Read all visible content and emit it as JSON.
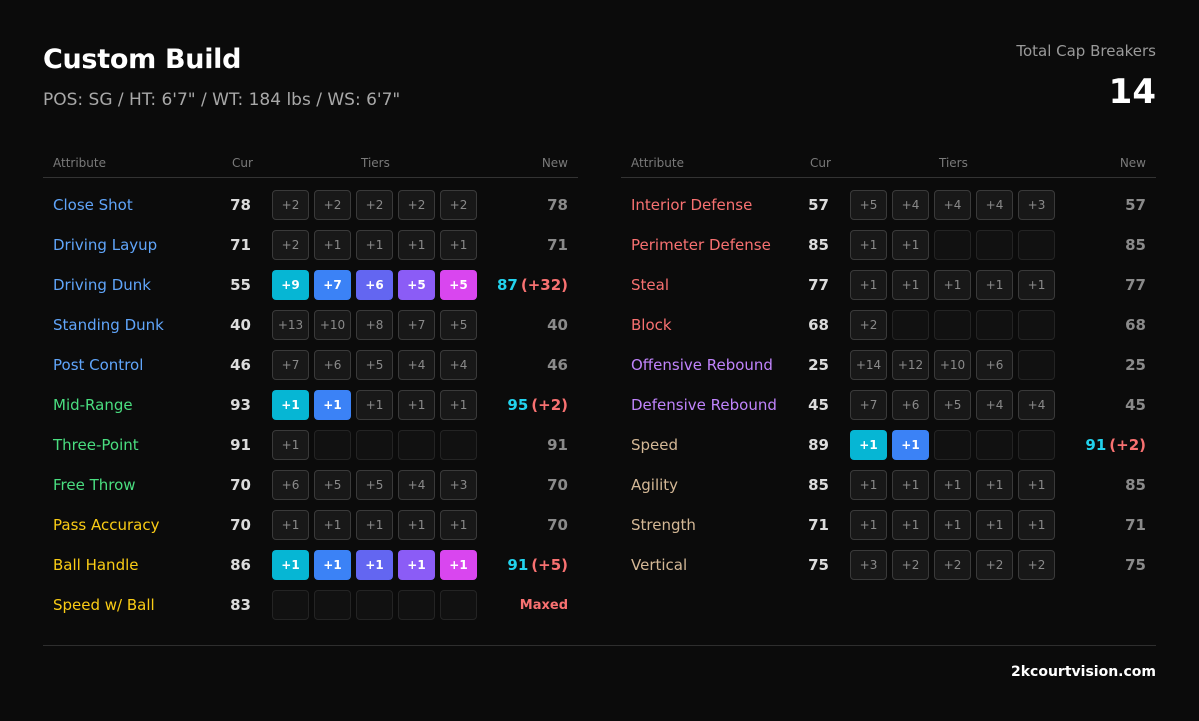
{
  "header": {
    "title": "Custom Build",
    "subtitle": "POS: SG / HT: 6'7\" / WT: 184 lbs / WS: 6'7\"",
    "cap_label": "Total Cap Breakers",
    "cap_value": "14"
  },
  "columns": {
    "attribute": "Attribute",
    "cur": "Cur",
    "tiers": "Tiers",
    "new": "New"
  },
  "colors": {
    "finishing": "#60a5fa",
    "shooting": "#4ade80",
    "playmaking": "#facc15",
    "defense": "#f87171",
    "rebounding": "#c084fc",
    "physical": "#d4b896",
    "tier_gradient": [
      "#06b6d4",
      "#3b82f6",
      "#6366f1",
      "#8b5cf6",
      "#d946ef"
    ]
  },
  "left": [
    {
      "name": "Close Shot",
      "group": "finishing",
      "cur": "78",
      "tiers": [
        "+2",
        "+2",
        "+2",
        "+2",
        "+2"
      ],
      "active": 0,
      "new": "78"
    },
    {
      "name": "Driving Layup",
      "group": "finishing",
      "cur": "71",
      "tiers": [
        "+2",
        "+1",
        "+1",
        "+1",
        "+1"
      ],
      "active": 0,
      "new": "71"
    },
    {
      "name": "Driving Dunk",
      "group": "finishing",
      "cur": "55",
      "tiers": [
        "+9",
        "+7",
        "+6",
        "+5",
        "+5"
      ],
      "active": 5,
      "new": "87",
      "delta": "(+32)"
    },
    {
      "name": "Standing Dunk",
      "group": "finishing",
      "cur": "40",
      "tiers": [
        "+13",
        "+10",
        "+8",
        "+7",
        "+5"
      ],
      "active": 0,
      "new": "40"
    },
    {
      "name": "Post Control",
      "group": "finishing",
      "cur": "46",
      "tiers": [
        "+7",
        "+6",
        "+5",
        "+4",
        "+4"
      ],
      "active": 0,
      "new": "46"
    },
    {
      "name": "Mid-Range",
      "group": "shooting",
      "cur": "93",
      "tiers": [
        "+1",
        "+1",
        "+1",
        "+1",
        "+1"
      ],
      "active": 2,
      "new": "95",
      "delta": "(+2)"
    },
    {
      "name": "Three-Point",
      "group": "shooting",
      "cur": "91",
      "tiers": [
        "+1",
        "",
        "",
        "",
        ""
      ],
      "active": 0,
      "new": "91"
    },
    {
      "name": "Free Throw",
      "group": "shooting",
      "cur": "70",
      "tiers": [
        "+6",
        "+5",
        "+5",
        "+4",
        "+3"
      ],
      "active": 0,
      "new": "70"
    },
    {
      "name": "Pass Accuracy",
      "group": "playmaking",
      "cur": "70",
      "tiers": [
        "+1",
        "+1",
        "+1",
        "+1",
        "+1"
      ],
      "active": 0,
      "new": "70"
    },
    {
      "name": "Ball Handle",
      "group": "playmaking",
      "cur": "86",
      "tiers": [
        "+1",
        "+1",
        "+1",
        "+1",
        "+1"
      ],
      "active": 5,
      "new": "91",
      "delta": "(+5)"
    },
    {
      "name": "Speed w/ Ball",
      "group": "playmaking",
      "cur": "83",
      "tiers": [
        "",
        "",
        "",
        "",
        ""
      ],
      "active": 0,
      "new": "Maxed",
      "maxed": true
    }
  ],
  "right": [
    {
      "name": "Interior Defense",
      "group": "defense",
      "cur": "57",
      "tiers": [
        "+5",
        "+4",
        "+4",
        "+4",
        "+3"
      ],
      "active": 0,
      "new": "57"
    },
    {
      "name": "Perimeter Defense",
      "group": "defense",
      "cur": "85",
      "tiers": [
        "+1",
        "+1",
        "",
        "",
        ""
      ],
      "active": 0,
      "new": "85"
    },
    {
      "name": "Steal",
      "group": "defense",
      "cur": "77",
      "tiers": [
        "+1",
        "+1",
        "+1",
        "+1",
        "+1"
      ],
      "active": 0,
      "new": "77"
    },
    {
      "name": "Block",
      "group": "defense",
      "cur": "68",
      "tiers": [
        "+2",
        "",
        "",
        "",
        ""
      ],
      "active": 0,
      "new": "68"
    },
    {
      "name": "Offensive Rebound",
      "group": "rebounding",
      "cur": "25",
      "tiers": [
        "+14",
        "+12",
        "+10",
        "+6",
        ""
      ],
      "active": 0,
      "new": "25"
    },
    {
      "name": "Defensive Rebound",
      "group": "rebounding",
      "cur": "45",
      "tiers": [
        "+7",
        "+6",
        "+5",
        "+4",
        "+4"
      ],
      "active": 0,
      "new": "45"
    },
    {
      "name": "Speed",
      "group": "physical",
      "cur": "89",
      "tiers": [
        "+1",
        "+1",
        "",
        "",
        ""
      ],
      "active": 2,
      "new": "91",
      "delta": "(+2)"
    },
    {
      "name": "Agility",
      "group": "physical",
      "cur": "85",
      "tiers": [
        "+1",
        "+1",
        "+1",
        "+1",
        "+1"
      ],
      "active": 0,
      "new": "85"
    },
    {
      "name": "Strength",
      "group": "physical",
      "cur": "71",
      "tiers": [
        "+1",
        "+1",
        "+1",
        "+1",
        "+1"
      ],
      "active": 0,
      "new": "71"
    },
    {
      "name": "Vertical",
      "group": "physical",
      "cur": "75",
      "tiers": [
        "+3",
        "+2",
        "+2",
        "+2",
        "+2"
      ],
      "active": 0,
      "new": "75"
    }
  ],
  "footer": {
    "site": "2kcourtvision.com"
  }
}
